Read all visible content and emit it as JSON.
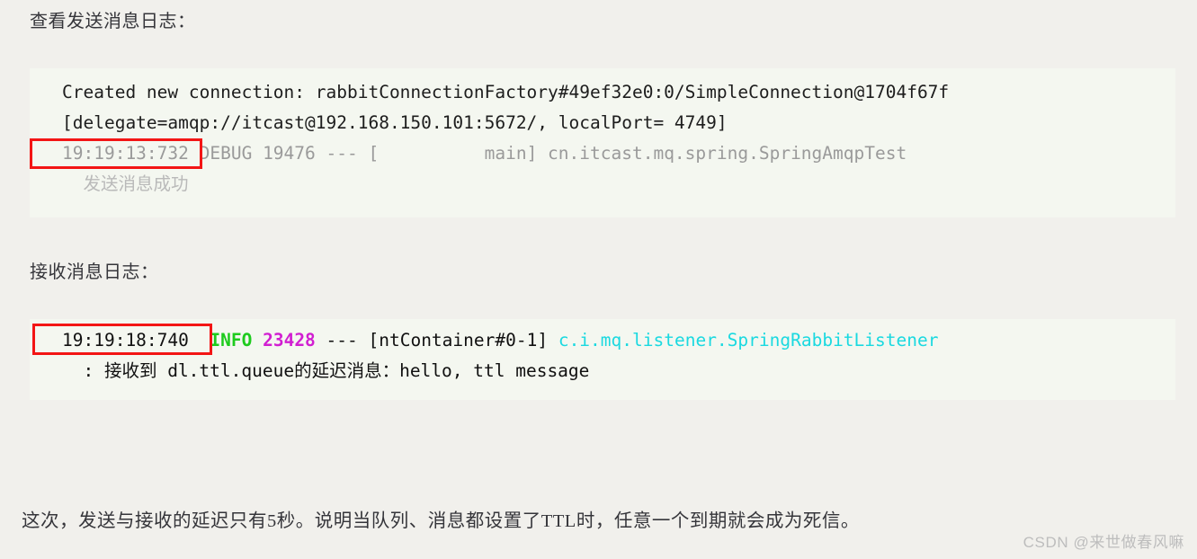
{
  "page": {
    "background_color": "#f1f0ec",
    "code_block_color": "#f4f7f0",
    "annotation_color": "#f31515"
  },
  "headings": {
    "send_log": "查看发送消息日志：",
    "receive_log": "接收消息日志："
  },
  "send_log_block": {
    "lines": [
      {
        "id": "line-1",
        "segments": [
          {
            "text": "Created new connection: rabbitConnectionFactory#49ef32e0:0/SimpleConnection@1704f67f",
            "color": "dark"
          }
        ]
      },
      {
        "id": "line-2",
        "segments": [
          {
            "text": "[delegate=amqp://itcast@192.168.150.101:5672/, localPort= 4749]",
            "color": "dark"
          }
        ]
      },
      {
        "id": "line-3",
        "segments": [
          {
            "text": "19:19:13:732",
            "color": "gray"
          },
          {
            "text": " DEBUG 19476 --- [          main] cn.itcast.mq.spring.SpringAmqpTest",
            "color": "gray"
          }
        ]
      },
      {
        "id": "line-4",
        "segments": [
          {
            "text": "  发送消息成功",
            "color": "gray-light"
          }
        ]
      }
    ],
    "highlight_timestamp": "19:19:13:732"
  },
  "receive_log_block": {
    "lines": [
      {
        "id": "line-1",
        "segments": [
          {
            "text": "19:19:18:740",
            "color": "black"
          },
          {
            "text": "  ",
            "color": "black"
          },
          {
            "text": "INFO",
            "color": "green"
          },
          {
            "text": " ",
            "color": "black"
          },
          {
            "text": "23428",
            "color": "magenta"
          },
          {
            "text": " --- [ntContainer#0-1] ",
            "color": "black"
          },
          {
            "text": "c.i.mq.listener.SpringRabbitListener",
            "color": "cyan"
          }
        ]
      },
      {
        "id": "line-2",
        "segments": [
          {
            "text": "  : 接收到 dl.ttl.queue的延迟消息：hello, ttl message",
            "color": "black"
          }
        ]
      }
    ],
    "highlight_timestamp": "19:19:18:740"
  },
  "conclusion": "这次，发送与接收的延迟只有5秒。说明当队列、消息都设置了TTL时，任意一个到期就会成为死信。",
  "watermark": "CSDN @来世做春风嘛"
}
